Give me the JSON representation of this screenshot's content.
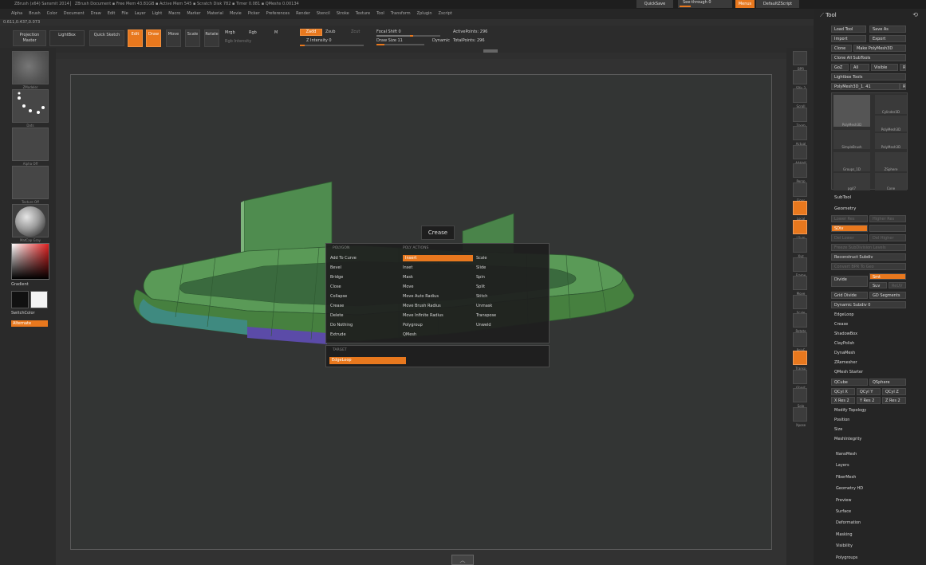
{
  "titlebar": {
    "text": "ZBrush (x64) Sansmit 2014 ▏                 ZBrush Document      ▪ Free Mem 43.81GB ▪ Active Mem 545 ▪ Scratch Disk 782 ▪ Timer 0.081 ▪ QMeshs 0.00134"
  },
  "topright": {
    "quicksave": "QuickSave",
    "seethrough": "See-through 0",
    "menus": "Menus",
    "defaultscript": "DefaultZScript"
  },
  "menus": [
    "Alpha",
    "Brush",
    "Color",
    "Document",
    "Draw",
    "Edit",
    "File",
    "Layer",
    "Light",
    "Macro",
    "Marker",
    "Material",
    "Movie",
    "Picker",
    "Preferences",
    "Render",
    "Stencil",
    "Stroke",
    "Texture",
    "Tool",
    "Transform",
    "Zplugin",
    "Zscript"
  ],
  "coords": "0.611,0.437,0.073",
  "toolbar": {
    "projection_master": "Projection Master",
    "lightbox": "LightBox",
    "quick_sketch": "Quick Sketch",
    "edit": "Edit",
    "draw": "Draw",
    "move": "Move",
    "scale": "Scale",
    "rotate": "Rotate",
    "mrgb": "Mrgb",
    "rgb": "Rgb",
    "m": "M",
    "rgb_intensity": "Rgb Intensity",
    "zadd": "Zadd",
    "zsub": "Zsub",
    "zcut": "Zcut",
    "z_intensity": "Z Intensity 0",
    "focal_shift": "Focal Shift 0",
    "draw_size": "Draw Size 11",
    "dynamic": "Dynamic",
    "active_points": "ActivePoints: 296",
    "total_points": "TotalPoints: 296"
  },
  "leftshelf": {
    "brush": "ZModeler",
    "stroke": "Dots",
    "alpha": "Alpha Off",
    "texture": "Texture Off",
    "material": "MatCap Gray",
    "gradient": "Gradient",
    "switch": "SwitchColor",
    "alternate": "Alternate"
  },
  "rightshelf": [
    "BPR",
    "SPix 3",
    "Scroll",
    "Zoom",
    "Actual",
    "AAHalf",
    "Persp",
    "Floor",
    "Local",
    "LSym",
    "Xyz",
    "Frame",
    "Move",
    "Scale",
    "Rotate",
    "PolyF",
    "Transp",
    "Ghost",
    "Solo",
    "Xpose"
  ],
  "tooltip": "Crease",
  "popup": {
    "polygon_header": "POLYGON",
    "poly_actions_header": "POLY ACTIONS",
    "col1": [
      "Add To Curve",
      "Bevel",
      "Bridge",
      "Close",
      "Collapse",
      "Crease",
      "Delete",
      "Do Nothing",
      "Extrude"
    ],
    "col2": [
      "Insert",
      "Inset",
      "Mask",
      "Move",
      "Move Auto Radius",
      "Move Brush Radius",
      "Move Infinite Radius",
      "Polygroup",
      "QMesh"
    ],
    "col3": [
      "Scale",
      "Slide",
      "Spin",
      "Split",
      "Stitch",
      "Unmask",
      "Transpose",
      "Unweld"
    ],
    "selected": "Insert",
    "target_header": "TARGET",
    "target_value": "EdgeLoop"
  },
  "tray": {
    "title": "Tool",
    "load_tool": "Load Tool",
    "save_as": "Save As",
    "import": "Import",
    "export": "Export",
    "clone": "Clone",
    "make_polymesh": "Make PolyMesh3D",
    "clone_all": "Clone All SubTools",
    "goz": "GoZ",
    "all": "All",
    "visible": "Visible",
    "r": "R",
    "lightbox_tools": "Lightbox Tools",
    "polymesh": "PolyMesh3D_1. 41",
    "tools": [
      "PolyMesh3D",
      "Cylinder3D",
      "PolyMesh3D",
      "SimpleBrush",
      "PolyMesh3D",
      "Groups_1D",
      "ZSphere",
      "pg47",
      "Cone"
    ],
    "subtool": "SubTool",
    "geometry": "Geometry",
    "geo_buttons": [
      "Lower Res",
      "Higher Res",
      "SDiv",
      "Del Lower",
      "Del Higher",
      "Freeze SubDivision Levels"
    ],
    "reconstruct": "Reconstruct Subdiv",
    "convert_bpr": "Convert BPR To Geo",
    "divide": "Divide",
    "smt": "Smt",
    "suv": "Suv",
    "rsmt": "ReUV",
    "edge_loop_btn": "Grid Divide",
    "gd_segments": "GD Segments",
    "dynamic_sub": "Dynamic Subdiv 0",
    "subs": [
      "EdgeLoop",
      "Crease",
      "ShadowBox",
      "ClayPolish",
      "DynaMesh",
      "ZRemesher"
    ],
    "qmesh_starter": "QMesh Starter",
    "qcube": "QCube",
    "qsphere": "QSphere",
    "qcyl_x": "QCyl X",
    "qcyl_y": "QCyl Y",
    "qcyl_z": "QCyl Z",
    "xres": "X Res 2",
    "yres": "Y Res 2",
    "zres": "Z Res 2",
    "subs2": [
      "Modify Topology",
      "Position",
      "Size",
      "MeshIntegrity"
    ],
    "sections": [
      "NanoMesh",
      "Layers",
      "FiberMesh",
      "Geometry HD",
      "Preview",
      "Surface",
      "Deformation",
      "Masking",
      "Visibility",
      "Polygroups"
    ]
  },
  "colors": {
    "accent": "#e8781e",
    "model": "#4e8a4e",
    "model_dark": "#3a6b3c",
    "panel": "#252525"
  }
}
